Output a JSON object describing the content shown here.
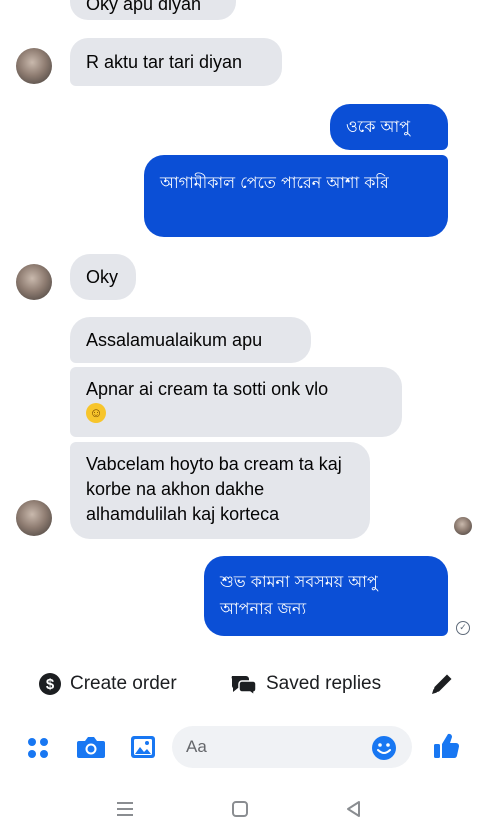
{
  "messages": [
    {
      "id": "m0",
      "dir": "in",
      "text": "Oky apu diyan"
    },
    {
      "id": "m1",
      "dir": "in",
      "text": "R aktu tar tari diyan"
    },
    {
      "id": "m2",
      "dir": "out",
      "text": "ওকে আপু"
    },
    {
      "id": "m3",
      "dir": "out",
      "text": "আগামীকাল পেতে পারেন আশা করি"
    },
    {
      "id": "m4",
      "dir": "in",
      "text": "Oky"
    },
    {
      "id": "m5",
      "dir": "in",
      "text": "Assalamualaikum apu"
    },
    {
      "id": "m6",
      "dir": "in",
      "text": "Apnar ai cream ta sotti onk vlo",
      "emoji": "smiling-face"
    },
    {
      "id": "m7",
      "dir": "in",
      "text": "Vabcelam hoyto ba cream ta kaj korbe na akhon dakhe alhamdulilah kaj korteca"
    },
    {
      "id": "m8",
      "dir": "out",
      "text": "শুভ কামনা সবসময় আপু আপনার জন্য"
    }
  ],
  "quick_actions": {
    "create_order": "Create order",
    "saved_replies": "Saved replies"
  },
  "composer": {
    "placeholder": "Aa"
  },
  "colors": {
    "outgoing_bubble": "#0b4fd6",
    "incoming_bubble": "#e4e6eb",
    "accent": "#1877f2"
  },
  "icons": [
    "dollar-icon",
    "saved-replies-icon",
    "pencil-icon",
    "apps-grid-icon",
    "camera-icon",
    "gallery-icon",
    "emoji-icon",
    "like-icon",
    "nav-menu-icon",
    "nav-home-icon",
    "nav-back-icon"
  ]
}
